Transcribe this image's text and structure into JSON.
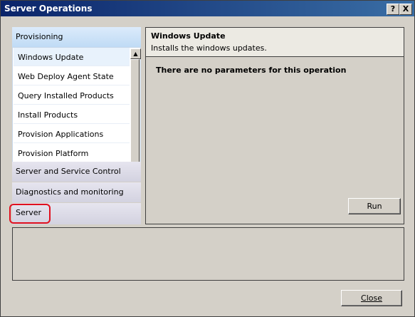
{
  "window": {
    "title": "Server Operations",
    "help_label": "?",
    "close_label": "X"
  },
  "nav": {
    "active_group": "Provisioning",
    "items": [
      "Windows Update",
      "Web Deploy Agent State",
      "Query Installed Products",
      "Install Products",
      "Provision Applications",
      "Provision Platform"
    ],
    "selected_item": "Windows Update",
    "groups": [
      "Server and Service Control",
      "Diagnostics and monitoring",
      "Server"
    ],
    "highlighted_group": "Server",
    "highlight_color": "#e0101e"
  },
  "detail": {
    "title": "Windows Update",
    "description": "Installs the windows updates.",
    "message": "There are no parameters for this operation",
    "run_label": "Run"
  },
  "footer": {
    "close_label": "Close"
  }
}
